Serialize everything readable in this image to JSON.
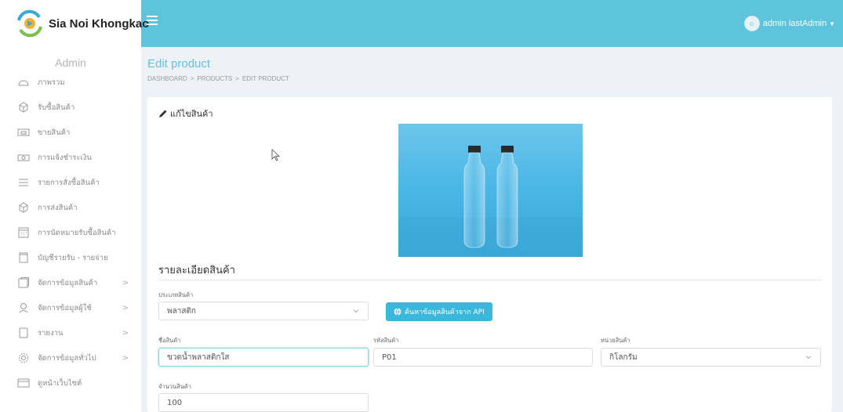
{
  "brand": {
    "name": "Sia Noi Khongkao"
  },
  "user": {
    "name": "admin lastAdmin",
    "avatar_text": "☺"
  },
  "sidebar": {
    "title": "Admin",
    "items": [
      {
        "label": "ภาพรวม",
        "icon": "dashboard-icon"
      },
      {
        "label": "รับซื้อสินค้า",
        "icon": "box-icon"
      },
      {
        "label": "ขายสินค้า",
        "icon": "register-icon"
      },
      {
        "label": "การแจ้งชำระเงิน",
        "icon": "money-icon"
      },
      {
        "label": "รายการสั่งซื้อสินค้า",
        "icon": "list-icon"
      },
      {
        "label": "การส่งสินค้า",
        "icon": "box-icon"
      },
      {
        "label": "การนัดหมายรับซื้อสินค้า",
        "icon": "calendar-icon"
      },
      {
        "label": "บัญชีรายรับ - รายจ่าย",
        "icon": "book-icon"
      },
      {
        "label": "จัดการข้อมูลสินค้า",
        "icon": "product-icon",
        "has_children": true
      },
      {
        "label": "จัดการข้อมูลผู้ใช้",
        "icon": "user-icon",
        "has_children": true
      },
      {
        "label": "รายงาน",
        "icon": "report-icon",
        "has_children": true
      },
      {
        "label": "จัดการข้อมูลทั่วไป",
        "icon": "gear-icon",
        "has_children": true
      },
      {
        "label": "ดูหน้าเว็บไซต์",
        "icon": "monitor-icon"
      }
    ],
    "chevron": ">"
  },
  "page": {
    "title": "Edit product",
    "breadcrumb": [
      "DASHBOARD",
      "PRODUCTS",
      "EDIT PRODUCT"
    ],
    "breadcrumb_sep": ">"
  },
  "card": {
    "title": "แก้ไขสินค้า",
    "section_title": "รายละเอียดสินค้า"
  },
  "form": {
    "category": {
      "label": "ประเภทสินค้า",
      "value": "พลาสติก"
    },
    "api_button": "ค้นหาข้อมูลสินค้าจาก API",
    "name": {
      "label": "ชื่อสินค้า",
      "value": "ขวดน้ำพลาสติกใส"
    },
    "code": {
      "label": "รหัสสินค้า",
      "value": "P01"
    },
    "unit": {
      "label": "หน่วยสินค้า",
      "value": "กิโลกรัม"
    },
    "quantity": {
      "label": "จำนวนสินค้า",
      "value": "100"
    }
  },
  "colors": {
    "accent": "#5ec3dc",
    "button": "#39b8dc"
  }
}
